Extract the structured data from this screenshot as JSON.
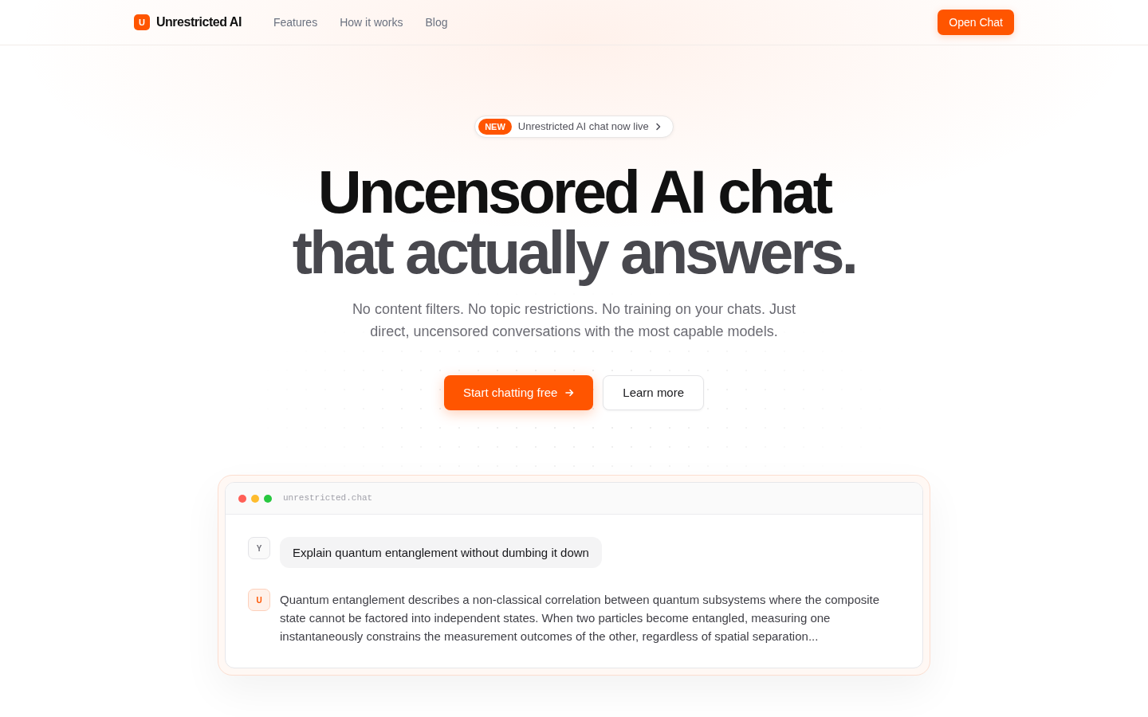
{
  "navbar": {
    "logo_letter": "U",
    "brand": "Unrestricted AI",
    "links": [
      "Features",
      "How it works",
      "Blog"
    ],
    "cta": "Open Chat"
  },
  "hero": {
    "announcement": {
      "badge": "NEW",
      "text": "Unrestricted AI chat now live"
    },
    "headline": [
      {
        "text": "Uncensored AI chat",
        "kind": "main"
      },
      {
        "text": "that actually answers.",
        "kind": "muted"
      }
    ],
    "subtitle": "No content filters. No topic restrictions. No training on your chats. Just direct, uncensored conversations with the most capable models.",
    "buttons": [
      {
        "label": "Start chatting free",
        "kind": "primary"
      },
      {
        "label": "Learn more",
        "kind": "secondary"
      }
    ]
  },
  "chat_preview": {
    "address": "unrestricted.chat",
    "messages": [
      {
        "kind": "user",
        "avatar": "Y",
        "text": "Explain quantum entanglement without dumbing it down"
      },
      {
        "kind": "assistant",
        "avatar": "U",
        "text": "Quantum entanglement describes a non-classical correlation between quantum subsystems where the composite state cannot be factored into independent states. When two particles become entangled, measuring one instantaneously constrains the measurement outcomes of the other, regardless of spatial separation..."
      }
    ]
  }
}
